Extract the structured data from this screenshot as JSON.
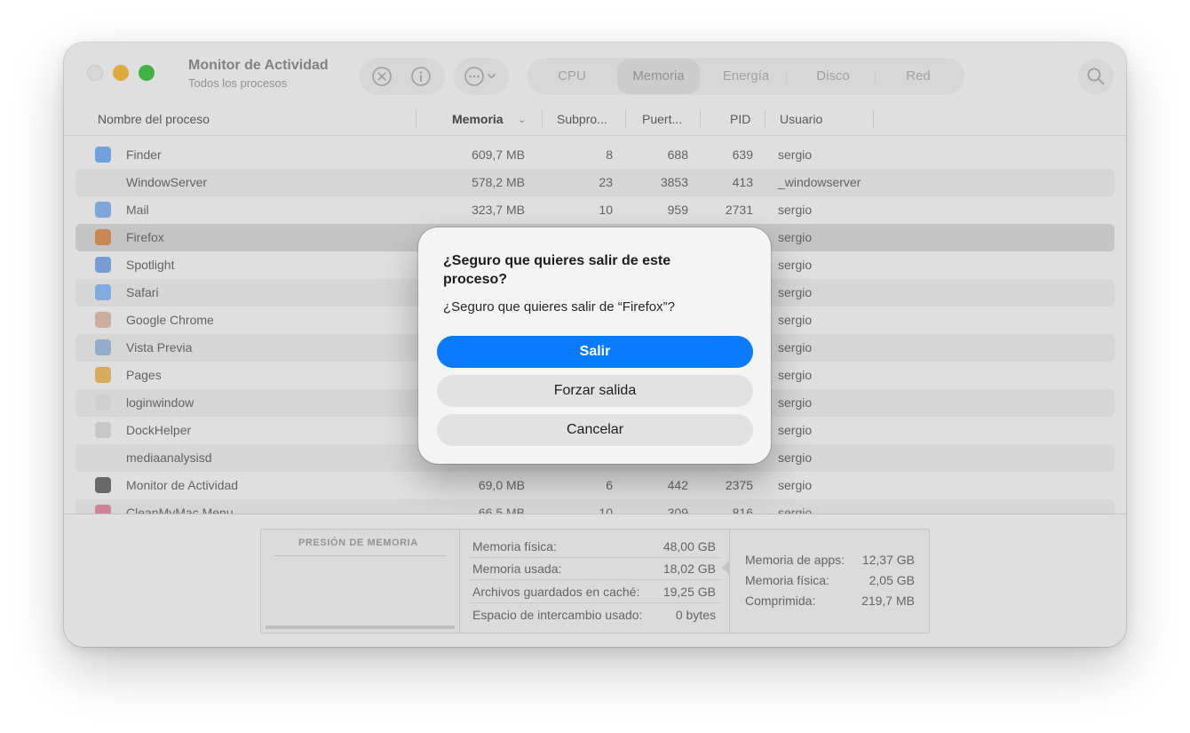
{
  "window": {
    "title": "Monitor de Actividad",
    "subtitle": "Todos los procesos"
  },
  "toolbar": {
    "stop_icon": "x-circle-icon",
    "info_icon": "info-icon",
    "more_icon": "ellipsis-icon",
    "tabs": [
      "CPU",
      "Memoria",
      "Energía",
      "Disco",
      "Red"
    ],
    "active_tab": "Memoria",
    "search_icon": "magnifying-glass-icon"
  },
  "columns": {
    "name": "Nombre del proceso",
    "memory": "Memoria",
    "threads": "Subpro...",
    "ports": "Puert...",
    "pid": "PID",
    "user": "Usuario"
  },
  "processes": [
    {
      "name": "Finder",
      "memory": "609,7 MB",
      "threads": "8",
      "ports": "688",
      "pid": "639",
      "user": "sergio",
      "icon": "finder-icon",
      "icon_color": "#7aa9e8"
    },
    {
      "name": "WindowServer",
      "memory": "578,2 MB",
      "threads": "23",
      "ports": "3853",
      "pid": "413",
      "user": "_windowserver",
      "icon": "",
      "icon_color": ""
    },
    {
      "name": "Mail",
      "memory": "323,7 MB",
      "threads": "10",
      "ports": "959",
      "pid": "2731",
      "user": "sergio",
      "icon": "mail-icon",
      "icon_color": "#86b1e6"
    },
    {
      "name": "Firefox",
      "memory": "",
      "threads": "",
      "ports": "",
      "pid": "",
      "user": "sergio",
      "icon": "firefox-icon",
      "icon_color": "#d78f56"
    },
    {
      "name": "Spotlight",
      "memory": "",
      "threads": "",
      "ports": "",
      "pid": "",
      "user": "sergio",
      "icon": "spotlight-icon",
      "icon_color": "#7ea6e0"
    },
    {
      "name": "Safari",
      "memory": "",
      "threads": "",
      "ports": "",
      "pid": "",
      "user": "sergio",
      "icon": "safari-icon",
      "icon_color": "#8ab5ea"
    },
    {
      "name": "Google Chrome",
      "memory": "",
      "threads": "",
      "ports": "",
      "pid": "",
      "user": "sergio",
      "icon": "chrome-icon",
      "icon_color": "#d7b8a8"
    },
    {
      "name": "Vista Previa",
      "memory": "",
      "threads": "",
      "ports": "",
      "pid": "",
      "user": "sergio",
      "icon": "preview-icon",
      "icon_color": "#9bb6d6"
    },
    {
      "name": "Pages",
      "memory": "",
      "threads": "",
      "ports": "",
      "pid": "",
      "user": "sergio",
      "icon": "pages-icon",
      "icon_color": "#e3b764"
    },
    {
      "name": "loginwindow",
      "memory": "",
      "threads": "",
      "ports": "",
      "pid": "",
      "user": "sergio",
      "icon": "loginwindow-icon",
      "icon_color": "#dcdcdc"
    },
    {
      "name": "DockHelper",
      "memory": "",
      "threads": "",
      "ports": "",
      "pid": "",
      "user": "sergio",
      "icon": "dockhelper-icon",
      "icon_color": "#d3d3d3"
    },
    {
      "name": "mediaanalysisd",
      "memory": "",
      "threads": "",
      "ports": "",
      "pid": "",
      "user": "sergio",
      "icon": "",
      "icon_color": ""
    },
    {
      "name": "Monitor de Actividad",
      "memory": "69,0 MB",
      "threads": "6",
      "ports": "442",
      "pid": "2375",
      "user": "sergio",
      "icon": "activity-monitor-icon",
      "icon_color": "#6f6f6f"
    },
    {
      "name": "CleanMyMac Menu",
      "memory": "66,5 MB",
      "threads": "10",
      "ports": "309",
      "pid": "816",
      "user": "sergio",
      "icon": "cleanmymac-icon",
      "icon_color": "#d98aa0"
    }
  ],
  "memory_panel": {
    "pressure_title": "PRESIÓN DE MEMORIA",
    "stats_left": [
      {
        "label": "Memoria física:",
        "value": "48,00 GB"
      },
      {
        "label": "Memoria usada:",
        "value": "18,02 GB"
      },
      {
        "label": "Archivos guardados en caché:",
        "value": "19,25 GB"
      },
      {
        "label": "Espacio de intercambio usado:",
        "value": "0 bytes"
      }
    ],
    "stats_right": [
      {
        "label": "Memoria de apps:",
        "value": "12,37 GB"
      },
      {
        "label": "Memoria física:",
        "value": "2,05 GB"
      },
      {
        "label": "Comprimida:",
        "value": "219,7 MB"
      }
    ]
  },
  "dialog": {
    "title": "¿Seguro que quieres salir de este proceso?",
    "message": "¿Seguro que quieres salir de “Firefox”?",
    "quit_label": "Salir",
    "force_quit_label": "Forzar salida",
    "cancel_label": "Cancelar"
  },
  "colors": {
    "accent": "#0a7aff",
    "traffic_min": "#e9b540",
    "traffic_max": "#44bc48"
  }
}
